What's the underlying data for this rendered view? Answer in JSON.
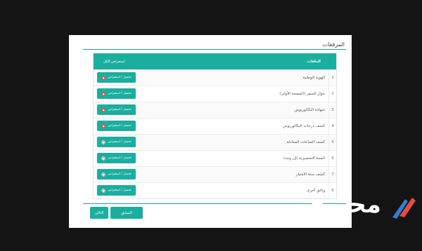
{
  "section": {
    "title": "المرفقات"
  },
  "table": {
    "header_files": "الملفات",
    "header_view_all": "استعراض الكل",
    "rows": [
      {
        "num": "1",
        "name": "الهوية الوطنية",
        "action": "تحميل / استعراض",
        "status": "red"
      },
      {
        "num": "2",
        "name": "جواز السفر (الصفحة الأولى)",
        "action": "تحميل / استعراض",
        "status": "red"
      },
      {
        "num": "3",
        "name": "شهادة البكالوريوس",
        "action": "تحميل / استعراض",
        "status": "red"
      },
      {
        "num": "4",
        "name": "كشف درجات البكالوريوس",
        "action": "تحميل / استعراض",
        "status": "red"
      },
      {
        "num": "5",
        "name": "كشف الساعات المعادلة",
        "action": "تحميل / استعراض",
        "status": "gray"
      },
      {
        "num": "6",
        "name": "السنة التحضيرية (إن وجد)",
        "action": "تحميل / استعراض",
        "status": "gray"
      },
      {
        "num": "7",
        "name": "كشف سنة الامتياز",
        "action": "تحميل / استعراض",
        "status": "gray"
      },
      {
        "num": "8",
        "name": "وثائق أخرى",
        "action": "تحميل / استعراض",
        "status": "gray"
      }
    ]
  },
  "nav": {
    "prev_label": "السابق",
    "next_label": "التالي"
  },
  "logo": {
    "text": "محتوى"
  },
  "colors": {
    "accent": "#1aae9f",
    "badge_red": "#e5533d",
    "badge_gray": "#bcbcbc"
  }
}
